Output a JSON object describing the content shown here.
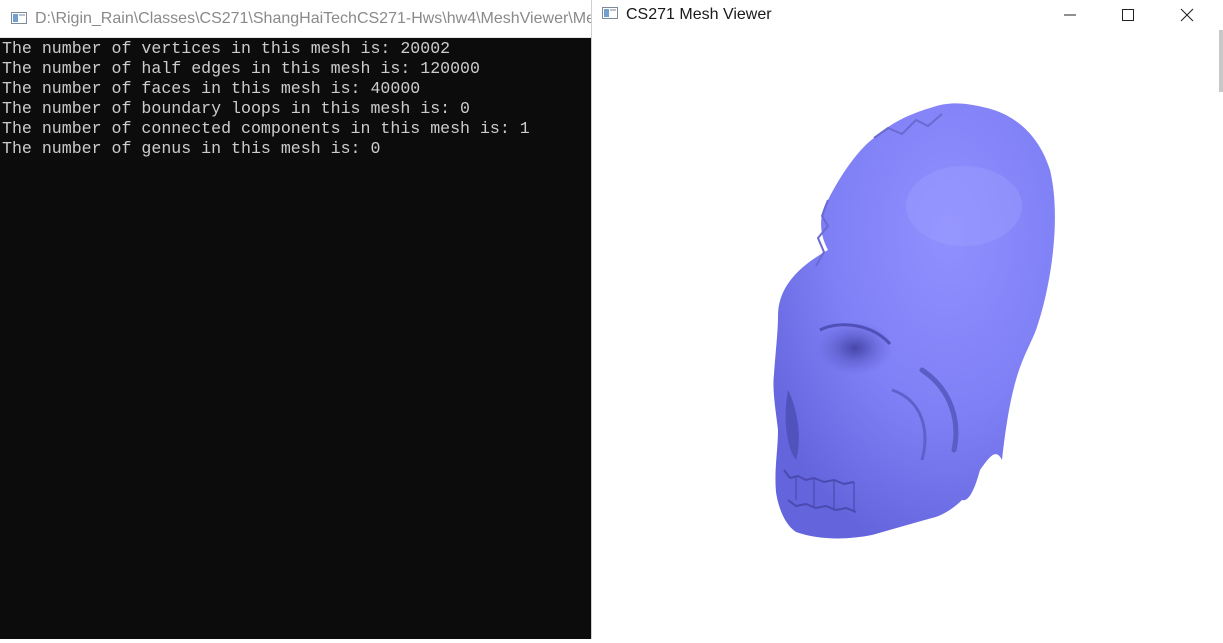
{
  "console": {
    "title": "D:\\Rigin_Rain\\Classes\\CS271\\ShangHaiTechCS271-Hws\\hw4\\MeshViewer\\Me",
    "lines": [
      "The number of vertices in this mesh is: 20002",
      "The number of half edges in this mesh is: 120000",
      "The number of faces in this mesh is: 40000",
      "The number of boundary loops in this mesh is: 0",
      "The number of connected components in this mesh is: 1",
      "The number of genus in this mesh is: 0"
    ],
    "colors": {
      "background": "#0c0c0c",
      "text": "#cccccc"
    }
  },
  "viewer": {
    "title": "CS271 Mesh Viewer",
    "controls": {
      "minimize": "minimize-icon",
      "maximize": "maximize-icon",
      "close": "close-icon"
    },
    "mesh_color": "#8080f8",
    "background": "#ffffff"
  }
}
